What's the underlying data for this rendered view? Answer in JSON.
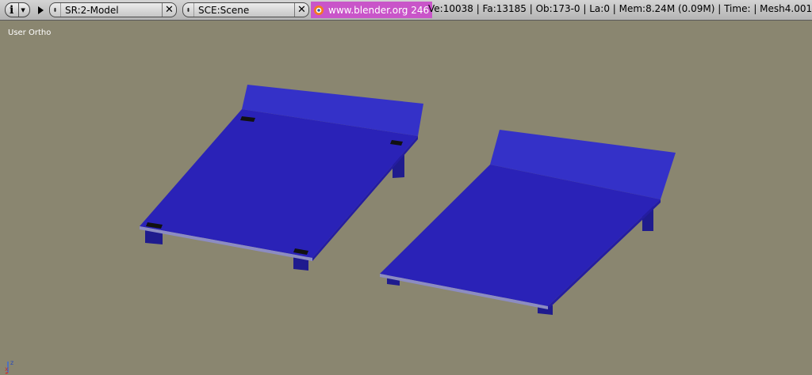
{
  "header": {
    "info_icon": "i-info-icon",
    "screen": {
      "value": "SR:2-Model"
    },
    "scene": {
      "value": "SCE:Scene"
    },
    "url": "www.blender.org 246",
    "stats": "Ve:10038 | Fa:13185 | Ob:173-0 | La:0  | Mem:8.24M (0.09M)  | Time: | Mesh4.001"
  },
  "viewport": {
    "label": "User Ortho",
    "background": "#8a8670",
    "objects": [
      "bed-left",
      "bed-right"
    ],
    "axis": {
      "x": "x",
      "z": "z"
    }
  },
  "colors": {
    "bed_top": "#2a22b8",
    "bed_headboard": "#3531c9",
    "bed_leg": "#1e1a8a",
    "header_bg": "#c4c4c4",
    "url_bg": "#c955c9"
  }
}
